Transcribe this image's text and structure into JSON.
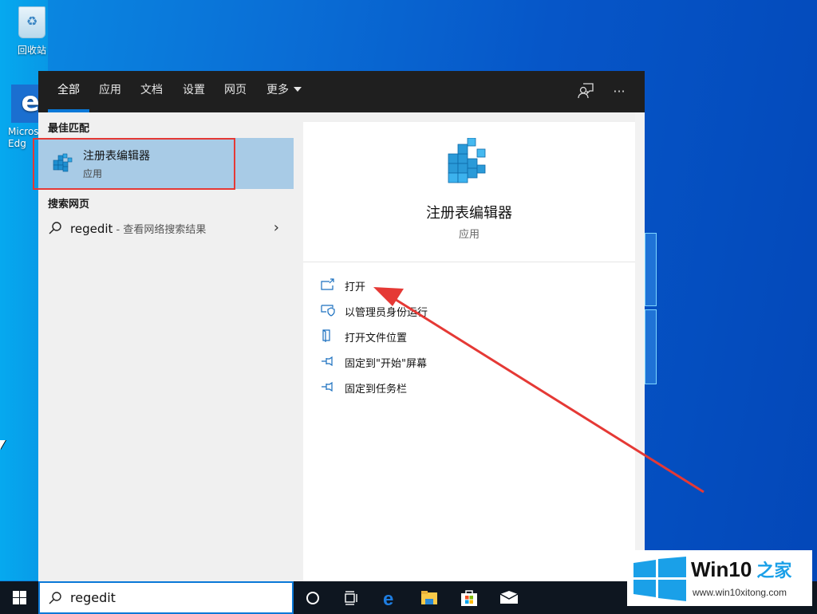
{
  "desktop": {
    "icons": [
      {
        "label": "回收站",
        "icon": "recycle-bin-icon"
      },
      {
        "label": "Micros\nEdg",
        "icon": "edge-icon"
      }
    ]
  },
  "search_panel": {
    "tabs": [
      {
        "label": "全部",
        "active": true
      },
      {
        "label": "应用",
        "active": false
      },
      {
        "label": "文档",
        "active": false
      },
      {
        "label": "设置",
        "active": false
      },
      {
        "label": "网页",
        "active": false
      },
      {
        "label": "更多",
        "active": false,
        "dropdown": true
      }
    ],
    "top_actions": [
      {
        "icon": "feedback-icon"
      },
      {
        "icon": "more-options-icon",
        "glyph": "···"
      }
    ],
    "best_match_header": "最佳匹配",
    "best_match": {
      "title": "注册表编辑器",
      "subtitle": "应用",
      "icon": "registry-editor-icon"
    },
    "web_header": "搜索网页",
    "web_result": {
      "query": "regedit",
      "suffix": " - 查看网络搜索结果",
      "chevron": "›"
    },
    "detail": {
      "title": "注册表编辑器",
      "subtitle": "应用",
      "actions": [
        {
          "label": "打开",
          "icon": "open-icon"
        },
        {
          "label": "以管理员身份运行",
          "icon": "run-as-admin-icon"
        },
        {
          "label": "打开文件位置",
          "icon": "open-file-location-icon"
        },
        {
          "label": "固定到\"开始\"屏幕",
          "icon": "pin-icon"
        },
        {
          "label": "固定到任务栏",
          "icon": "pin-icon"
        }
      ]
    }
  },
  "taskbar": {
    "search_value": "regedit",
    "items": [
      "cortana-icon",
      "task-view-icon",
      "edge-icon",
      "file-explorer-icon",
      "store-icon",
      "mail-icon"
    ]
  },
  "annotation": {
    "color": "#e53935",
    "target": "打开"
  },
  "watermark": {
    "brand": "Win10",
    "brand_cn": "之家",
    "url": "www.win10xitong.com"
  },
  "colors": {
    "accent": "#0a78d7",
    "selection": "#a8cbe6",
    "topbar": "#1f1f1f",
    "taskbar": "#0e1620",
    "highlight_box": "#e53935"
  }
}
